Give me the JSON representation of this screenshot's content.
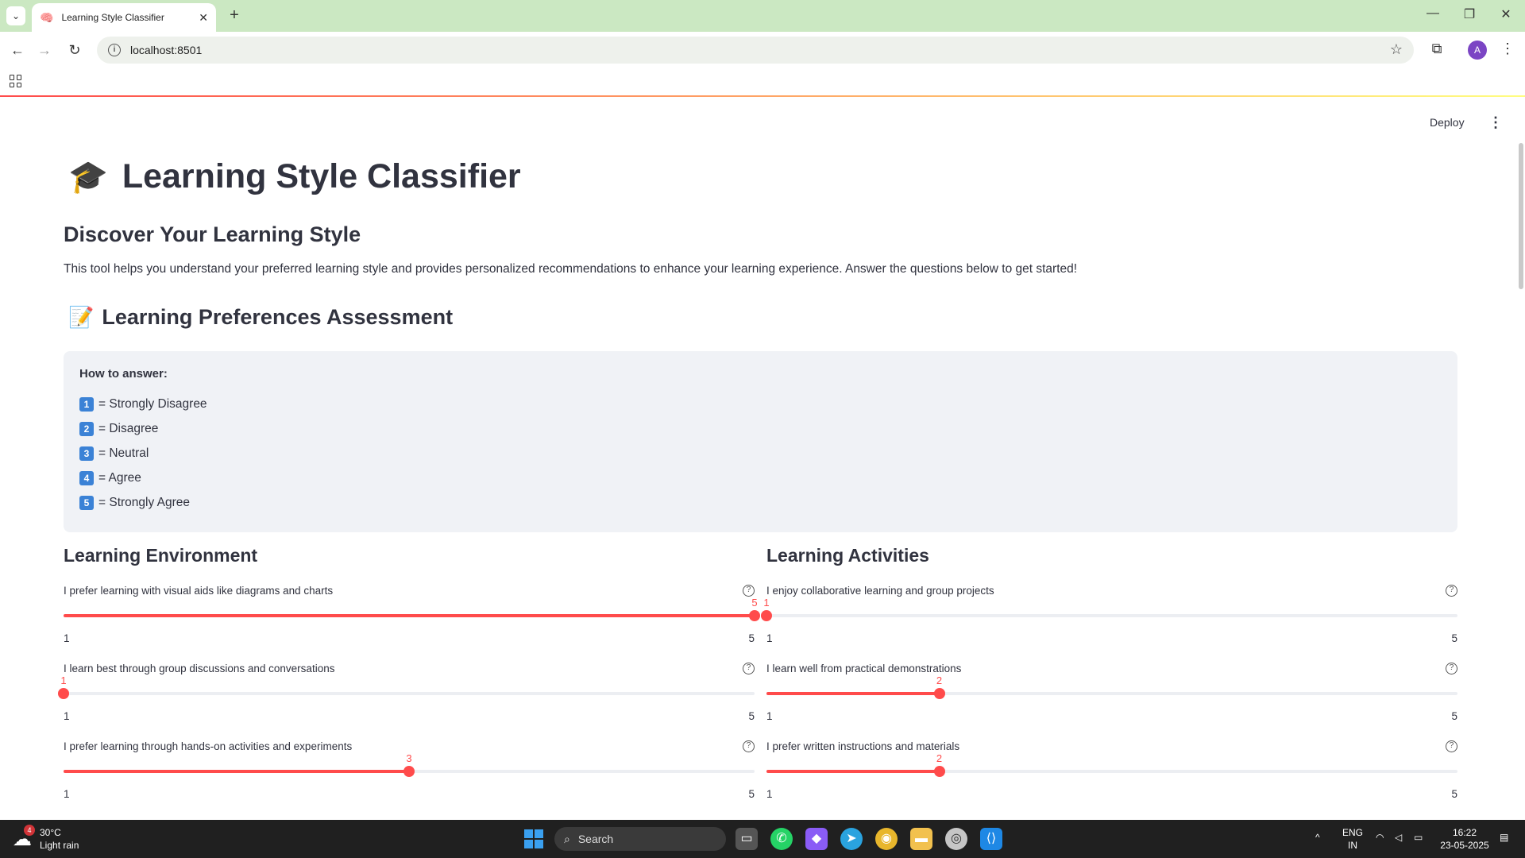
{
  "browser": {
    "tab_title": "Learning Style Classifier",
    "tab_favicon": "🧠",
    "url": "localhost:8501"
  },
  "app": {
    "deploy_label": "Deploy",
    "title_emoji": "🎓",
    "title": "Learning Style Classifier",
    "subtitle": "Discover Your Learning Style",
    "intro": "This tool helps you understand your preferred learning style and provides personalized recommendations to enhance your learning experience. Answer the questions below to get started!",
    "assessment_emoji": "📝",
    "assessment_title": "Learning Preferences Assessment",
    "how_to": {
      "heading": "How to answer:",
      "items": [
        {
          "key": "1",
          "text": "= Strongly Disagree"
        },
        {
          "key": "2",
          "text": "= Disagree"
        },
        {
          "key": "3",
          "text": "= Neutral"
        },
        {
          "key": "4",
          "text": "= Agree"
        },
        {
          "key": "5",
          "text": "= Strongly Agree"
        }
      ]
    },
    "columns": [
      {
        "title": "Learning Environment",
        "sliders": [
          {
            "label": "I prefer learning with visual aids like diagrams and charts",
            "value": 5,
            "min": 1,
            "max": 5
          },
          {
            "label": "I learn best through group discussions and conversations",
            "value": 1,
            "min": 1,
            "max": 5
          },
          {
            "label": "I prefer learning through hands-on activities and experiments",
            "value": 3,
            "min": 1,
            "max": 5
          }
        ]
      },
      {
        "title": "Learning Activities",
        "sliders": [
          {
            "label": "I enjoy collaborative learning and group projects",
            "value": 1,
            "min": 1,
            "max": 5
          },
          {
            "label": "I learn well from practical demonstrations",
            "value": 2,
            "min": 1,
            "max": 5
          },
          {
            "label": "I prefer written instructions and materials",
            "value": 2,
            "min": 1,
            "max": 5
          }
        ]
      }
    ],
    "accent_color": "#ff4b4b"
  },
  "taskbar": {
    "weather_temp": "30°C",
    "weather_desc": "Light rain",
    "weather_badge": "4",
    "search_placeholder": "Search",
    "lang_line1": "ENG",
    "lang_line2": "IN",
    "time": "16:22",
    "date": "23-05-2025"
  }
}
